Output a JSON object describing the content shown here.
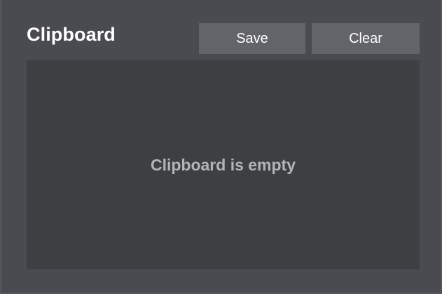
{
  "header": {
    "title": "Clipboard"
  },
  "toolbar": {
    "save_label": "Save",
    "clear_label": "Clear"
  },
  "content": {
    "empty_message": "Clipboard is empty"
  },
  "colors": {
    "background": "#4a4b50",
    "button": "#636469",
    "content_area": "#3e3f43",
    "title_text": "#ffffff",
    "empty_text": "#b3b4b8"
  }
}
